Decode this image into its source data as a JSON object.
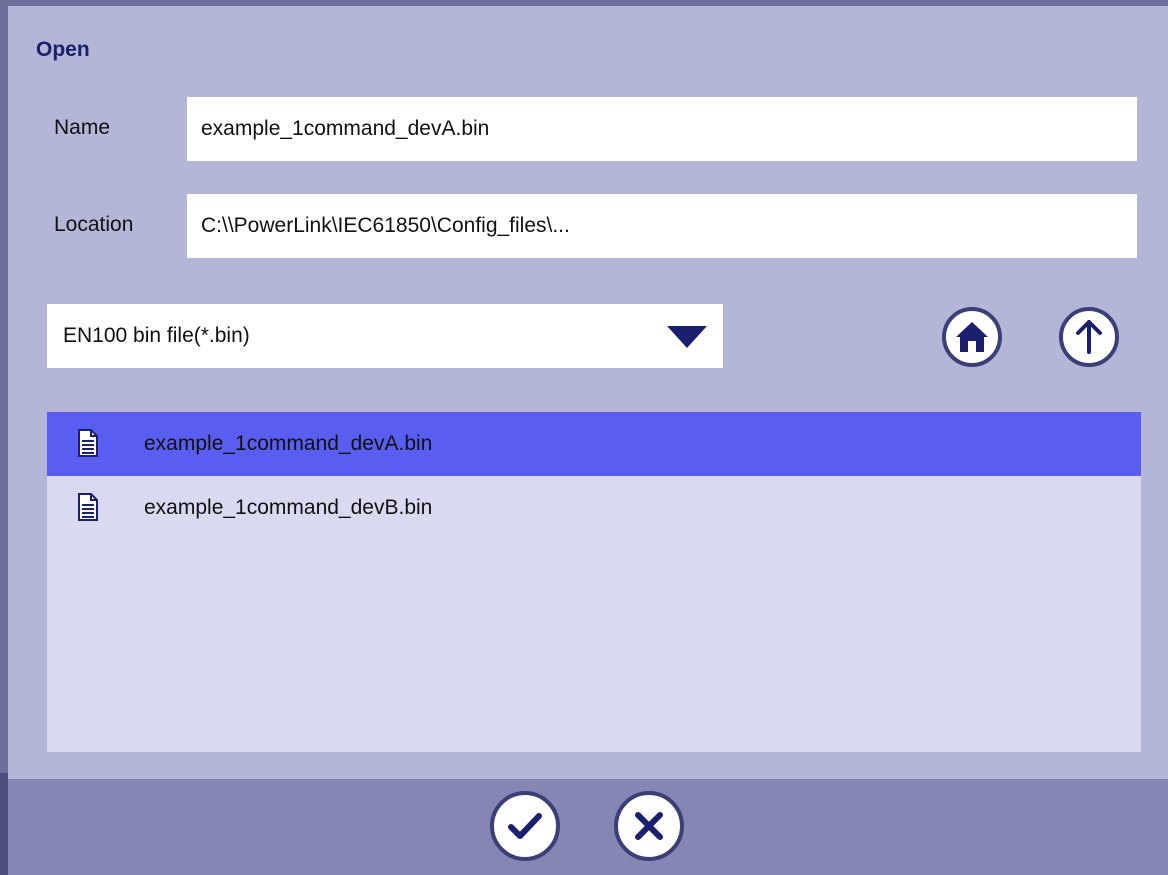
{
  "dialog": {
    "title": "Open"
  },
  "name_field": {
    "label": "Name",
    "value": "example_1command_devA.bin"
  },
  "location_field": {
    "label": "Location",
    "value": "C:\\\\PowerLink\\IEC61850\\Config_files\\..."
  },
  "filter": {
    "selected": "EN100 bin file(*.bin)"
  },
  "nav": {
    "home_icon": "home-icon",
    "up_icon": "arrow-up-icon"
  },
  "files": [
    {
      "name": "example_1command_devA.bin",
      "selected": true
    },
    {
      "name": "example_1command_devB.bin",
      "selected": false
    }
  ],
  "actions": {
    "confirm_icon": "checkmark-icon",
    "cancel_icon": "close-icon"
  },
  "colors": {
    "accent": "#5a5ef0",
    "dialog_bg": "#b4b6d8",
    "list_bg": "#d9daf1",
    "footer_bg": "#8586b4",
    "icon_dark": "#1a1f6e"
  }
}
